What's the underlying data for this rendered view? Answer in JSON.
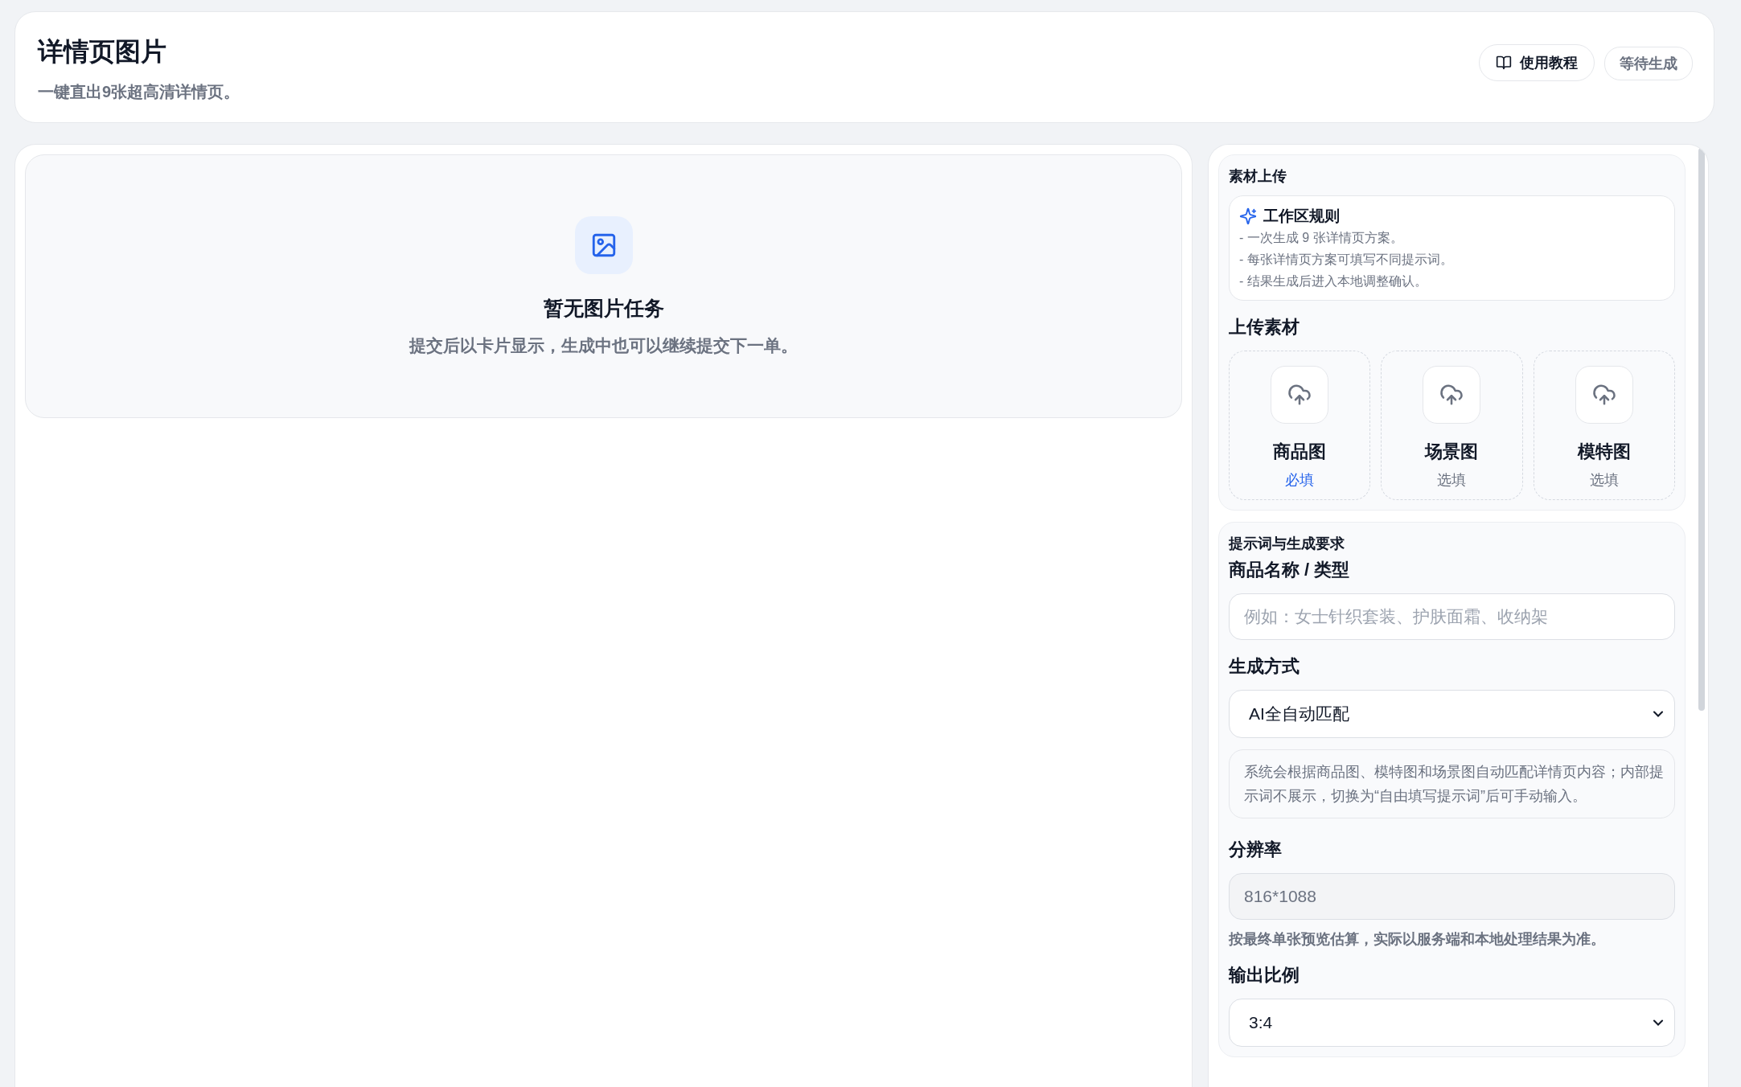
{
  "header": {
    "title": "详情页图片",
    "subtitle": "一键直出9张超高清详情页。",
    "guide_button": "使用教程",
    "status": "等待生成"
  },
  "empty_state": {
    "title": "暂无图片任务",
    "description": "提交后以卡片显示，生成中也可以继续提交下一单。"
  },
  "upload_section": {
    "heading": "素材上传",
    "rules": {
      "title": "工作区规则",
      "lines": [
        "- 一次生成 9 张详情页方案。",
        "- 每张详情页方案可填写不同提示词。",
        "- 结果生成后进入本地调整确认。"
      ]
    },
    "upload_heading": "上传素材",
    "slots": [
      {
        "label": "商品图",
        "requirement": "必填",
        "required": true
      },
      {
        "label": "场景图",
        "requirement": "选填",
        "required": false
      },
      {
        "label": "模特图",
        "requirement": "选填",
        "required": false
      }
    ]
  },
  "prompt_section": {
    "heading": "提示词与生成要求",
    "fields": [
      {
        "kind": "input",
        "label": "商品名称 / 类型",
        "placeholder": "例如：女士针织套装、护肤面霜、收纳架"
      },
      {
        "kind": "select",
        "label": "生成方式",
        "value": "AI全自动匹配"
      },
      {
        "kind": "note",
        "text": "系统会根据商品图、模特图和场景图自动匹配详情页内容；内部提示词不展示，切换为“自由填写提示词”后可手动输入。"
      },
      {
        "kind": "readonly",
        "label": "分辨率",
        "value": "816*1088",
        "hint": "按最终单张预览估算，实际以服务端和本地处理结果为准。"
      },
      {
        "kind": "select",
        "label": "输出比例",
        "value": "3:4"
      }
    ]
  }
}
